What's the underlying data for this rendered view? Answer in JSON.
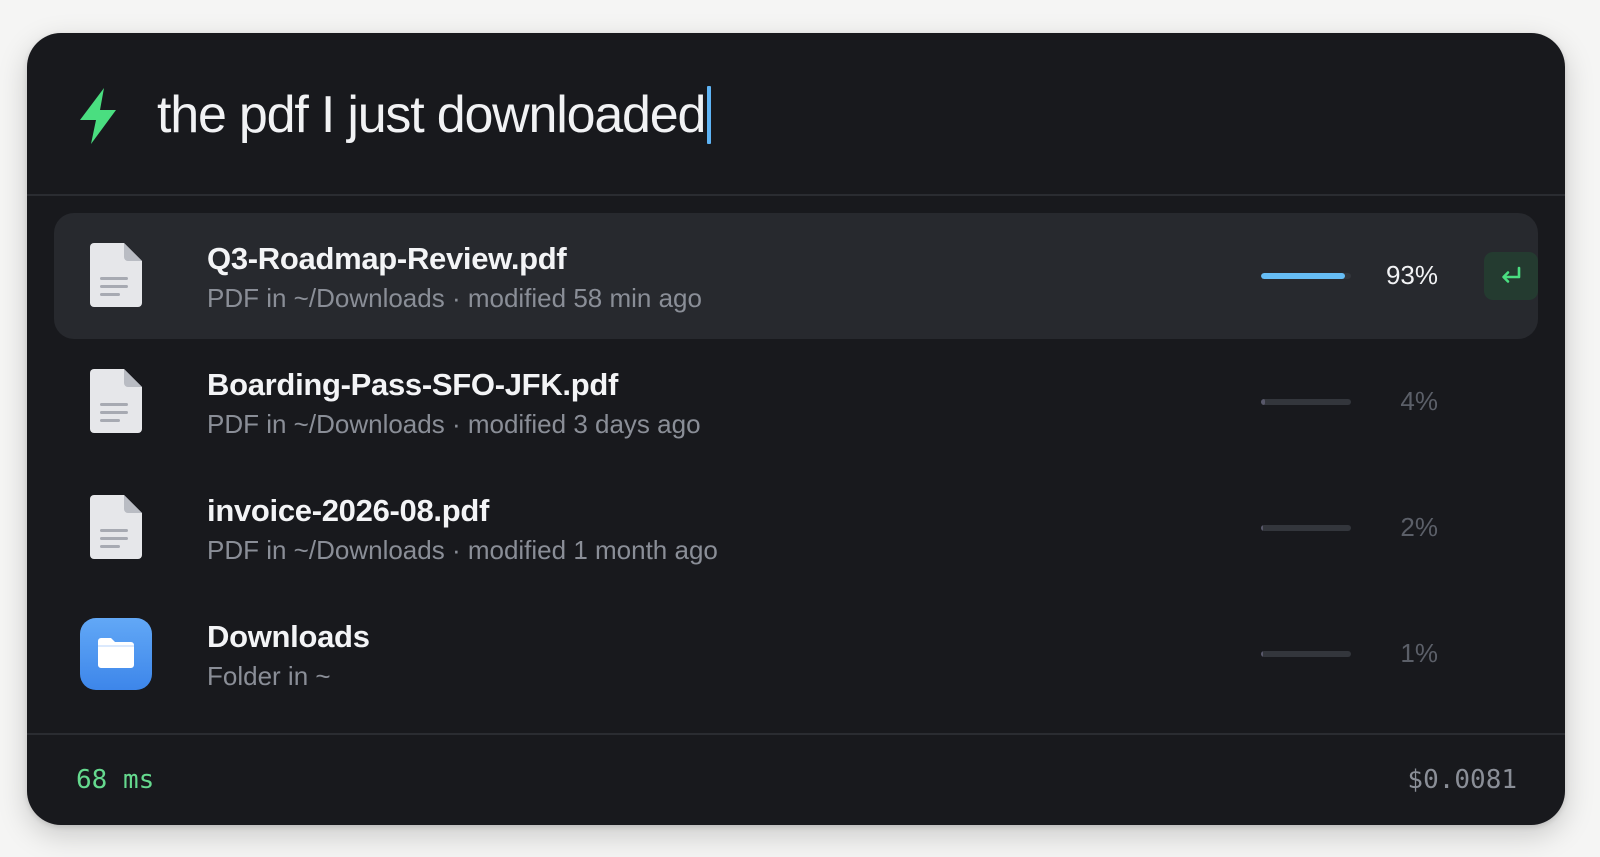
{
  "search": {
    "query": "the pdf I just downloaded",
    "icon": "bolt-icon",
    "accent_color": "#4ade80",
    "caret_color": "#5fb4f5"
  },
  "results": [
    {
      "title": "Q3-Roadmap-Review.pdf",
      "subtitle": "PDF in ~/Downloads · modified 58 min ago",
      "icon": "pdf-file-icon",
      "score_percent": 93,
      "score_label": "93%",
      "selected": true
    },
    {
      "title": "Boarding-Pass-SFO-JFK.pdf",
      "subtitle": "PDF in ~/Downloads · modified 3 days ago",
      "icon": "pdf-file-icon",
      "score_percent": 4,
      "score_label": "4%",
      "selected": false
    },
    {
      "title": "invoice-2026-08.pdf",
      "subtitle": "PDF in ~/Downloads · modified 1 month ago",
      "icon": "pdf-file-icon",
      "score_percent": 2,
      "score_label": "2%",
      "selected": false
    },
    {
      "title": "Downloads",
      "subtitle": "Folder in ~",
      "icon": "folder-icon",
      "score_percent": 1,
      "score_label": "1%",
      "selected": false
    }
  ],
  "enter_key": {
    "icon": "return-key-icon"
  },
  "footer": {
    "latency": "68 ms",
    "cost": "$0.0081"
  }
}
